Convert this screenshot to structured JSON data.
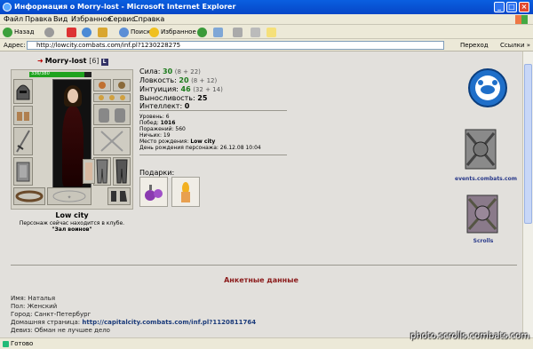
{
  "window": {
    "title": "Информация о Morry-lost - Microsoft Internet Explorer"
  },
  "menu": [
    "Файл",
    "Правка",
    "Вид",
    "Избранное",
    "Сервис",
    "Справка"
  ],
  "toolbar": {
    "back": "Назад",
    "search": "Поиск",
    "favorites": "Избранное"
  },
  "address": {
    "label": "Адрес:",
    "url": "http://lowcity.combats.com/inf.pl?1230228275",
    "go": "Переход",
    "links": "Ссылки »"
  },
  "character": {
    "name": "Morry-lost",
    "level": "[6]",
    "badge": "L",
    "hp": "336/380",
    "hp_fraction": 0.884,
    "city": "Low city",
    "location_line": "Персонаж сейчас находится в клубе.",
    "room": "\"Зал воинов\""
  },
  "stats": [
    {
      "label": "Сила:",
      "value": "30",
      "sub": "(8 + 22)"
    },
    {
      "label": "Ловкость:",
      "value": "20",
      "sub": "(8 + 12)"
    },
    {
      "label": "Интуиция:",
      "value": "46",
      "sub": "(32 + 14)"
    },
    {
      "label": "Выносливость:",
      "value": "25",
      "sub": ""
    },
    {
      "label": "Интеллект:",
      "value": "0",
      "sub": ""
    }
  ],
  "info": {
    "level": "Уровень: 6",
    "wins_label": "Побед:",
    "wins": "1016",
    "losses": "Поражений: 560",
    "draws": "Ничьих: 19",
    "birthplace_label": "Место рождения:",
    "birthplace": "Low city",
    "birthday": "День рождения персонажа: 26.12.08 10:04"
  },
  "gifts": {
    "label": "Подарки:"
  },
  "emblems": {
    "events": "events.combats.com",
    "scrolls": "Scrolls"
  },
  "profile": {
    "section_title": "Анкетные данные",
    "name": "Имя: Наталья",
    "gender": "Пол: Женский",
    "city": "Город: Санкт-Петербург",
    "homepage_label": "Домашняя страница:",
    "homepage": "http://capitalcity.combats.com/inf.pl?1120811764",
    "motto": "Девиз: Обман не лучшее дело"
  },
  "status": {
    "text": "Готово",
    "watermark": "photo.scrolls.combats.com"
  }
}
